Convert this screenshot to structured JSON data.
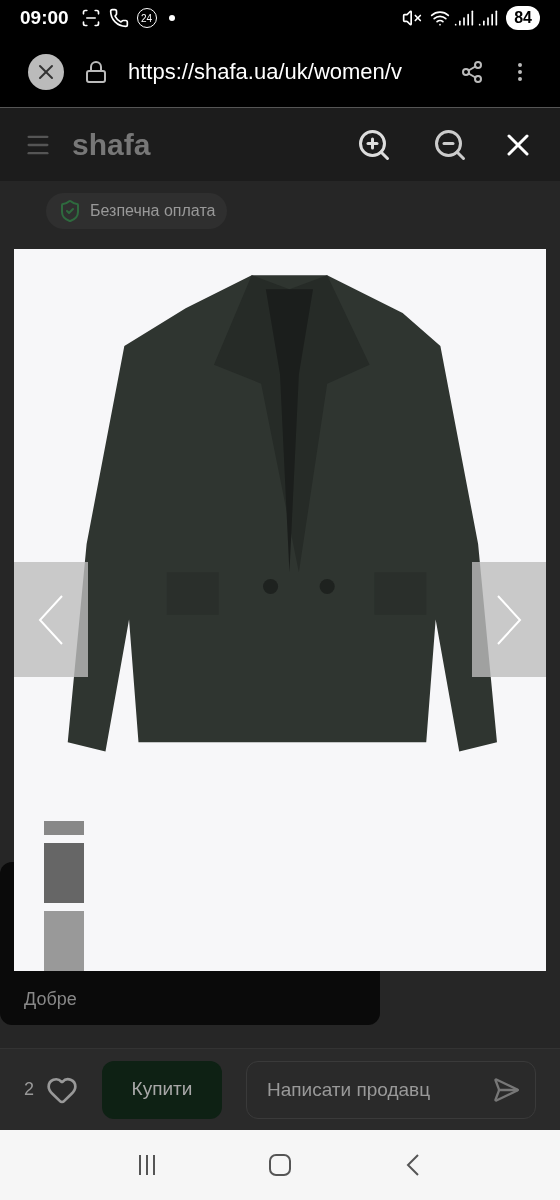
{
  "status_bar": {
    "time": "09:00",
    "notification_count": "24",
    "battery": "84"
  },
  "browser": {
    "url": "https://shafa.ua/uk/women/v"
  },
  "site_header": {
    "logo": "shafa"
  },
  "page": {
    "badge": "Безпечна оплата",
    "tooltip_text": "Добре"
  },
  "bottom_bar": {
    "likes": "2",
    "buy_button": "Купити",
    "message_field": {
      "placeholder": "Написати продавц"
    }
  }
}
